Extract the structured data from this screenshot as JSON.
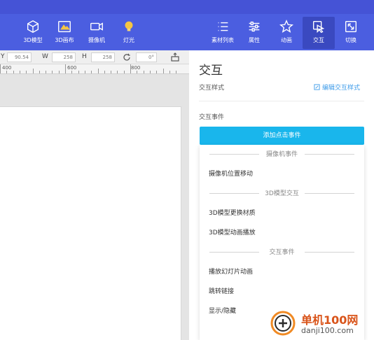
{
  "toolbar": {
    "left": [
      {
        "label": "3D模型",
        "icon": "cube-icon"
      },
      {
        "label": "3D画布",
        "icon": "canvas-3d-icon"
      },
      {
        "label": "摄像机",
        "icon": "camera-icon"
      },
      {
        "label": "灯光",
        "icon": "light-bulb-icon"
      }
    ],
    "right": [
      {
        "label": "素材列表",
        "icon": "list-icon"
      },
      {
        "label": "属性",
        "icon": "sliders-icon"
      },
      {
        "label": "动画",
        "icon": "star-icon"
      },
      {
        "label": "交互",
        "icon": "interaction-icon",
        "active": true
      },
      {
        "label": "切换",
        "icon": "switch-icon"
      }
    ]
  },
  "coords": {
    "y_label": "Y",
    "y_value": "90.54",
    "w_label": "W",
    "w_value": "258",
    "h_label": "H",
    "h_value": "258",
    "rotation_value": "0°"
  },
  "ruler": {
    "marks": [
      "400",
      "600",
      "800"
    ]
  },
  "panel": {
    "title": "交互",
    "style_label": "交互样式",
    "edit_link": "编辑交互样式",
    "events_label": "交互事件",
    "add_button": "添加点击事件"
  },
  "dropdown": {
    "groups": [
      {
        "title": "摄像机事件",
        "items": [
          "摄像机位置移动"
        ]
      },
      {
        "title": "3D模型交互",
        "items": [
          "3D模型更换材质",
          "3D模型动画播放"
        ]
      },
      {
        "title": "交互事件",
        "items": [
          "播放幻灯片动画",
          "跳转链接",
          "显示/隐藏"
        ]
      }
    ]
  },
  "watermark": {
    "name": "单机100网",
    "url": "danji100.com"
  },
  "colors": {
    "toolbar": "#4b5ee0",
    "button": "#19b6ec",
    "link": "#3d9be9"
  }
}
